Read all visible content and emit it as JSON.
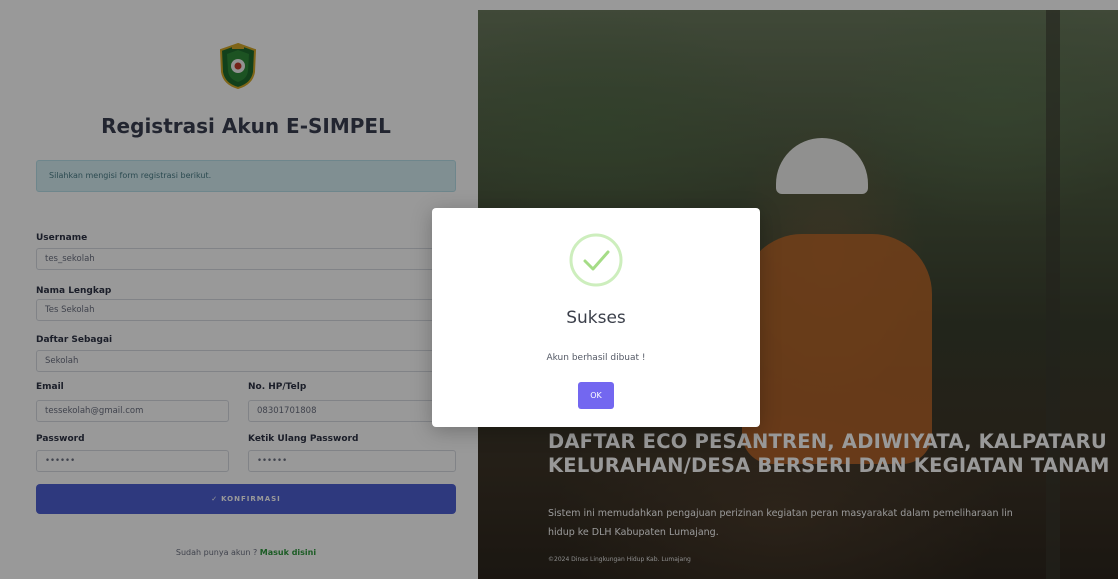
{
  "registration": {
    "title": "Registrasi Akun E-SIMPEL",
    "alert_text": "Silahkan mengisi form registrasi berikut.",
    "username_label": "Username",
    "username_value": "tes_sekolah",
    "fullname_label": "Nama Lengkap",
    "fullname_value": "Tes Sekolah",
    "role_label": "Daftar Sebagai",
    "role_value": "Sekolah",
    "email_label": "Email",
    "email_value": "tessekolah@gmail.com",
    "phone_label": "No. HP/Telp",
    "phone_value": "08301701808",
    "password_label": "Password",
    "password_value": "••••••",
    "confirm_password_label": "Ketik Ulang Password",
    "confirm_password_value": "••••••",
    "submit_label": "KONFIRMASI",
    "login_prompt": "Sudah punya akun ?",
    "login_link": "Masuk disini"
  },
  "hero": {
    "title_line1": "DAFTAR ECO PESANTREN, ADIWIYATA, KALPATARU",
    "title_line2": "KELURAHAN/DESA BERSERI DAN KEGIATAN TANAM",
    "description_line1": "Sistem ini memudahkan pengajuan perizinan kegiatan peran masyarakat dalam pemeliharaan lin",
    "description_line2": "hidup ke DLH Kabupaten Lumajang.",
    "footer": "©2024 Dinas Lingkungan Hidup Kab. Lumajang"
  },
  "modal": {
    "title": "Sukses",
    "message": "Akun berhasil dibuat !",
    "ok_label": "OK"
  },
  "colors": {
    "primary_button": "#4e5fd2",
    "ok_button": "#7367f0",
    "success_green": "#a5dc86",
    "link_green": "#2f9a3e",
    "alert_bg": "#d5eef3"
  }
}
